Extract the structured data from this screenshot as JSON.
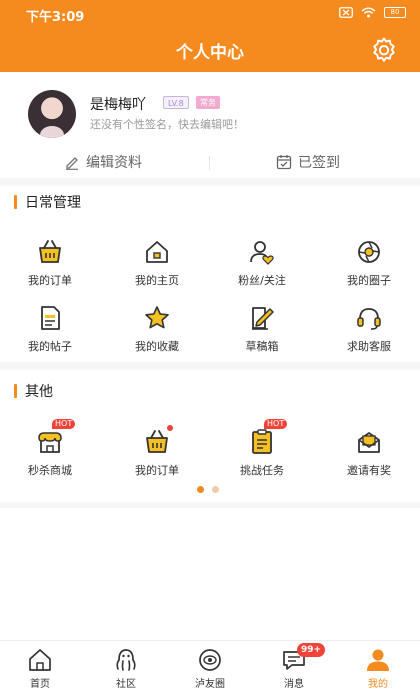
{
  "status_bar": {
    "time": "下午3:09",
    "battery": "80"
  },
  "header": {
    "title": "个人中心",
    "settings_icon": "gear-icon"
  },
  "profile": {
    "username": "是梅梅吖",
    "level_badge": "LV.8",
    "vip_badge": "常务",
    "signature": "还没有个性签名，快去编辑吧！"
  },
  "actions": {
    "edit_label": "编辑资料",
    "signin_label": "已签到"
  },
  "daily": {
    "title": "日常管理",
    "items": [
      {
        "label": "我的订单",
        "icon": "basket-icon"
      },
      {
        "label": "我的主页",
        "icon": "home-icon"
      },
      {
        "label": "粉丝/关注",
        "icon": "user-heart-icon"
      },
      {
        "label": "我的圈子",
        "icon": "aperture-icon"
      },
      {
        "label": "我的帖子",
        "icon": "document-icon"
      },
      {
        "label": "我的收藏",
        "icon": "star-icon"
      },
      {
        "label": "草稿箱",
        "icon": "pen-note-icon"
      },
      {
        "label": "求助客服",
        "icon": "headset-icon"
      }
    ]
  },
  "other": {
    "title": "其他",
    "items": [
      {
        "label": "秒杀商城",
        "icon": "shop-icon",
        "badge": "HOT"
      },
      {
        "label": "我的订单",
        "icon": "basket-icon"
      },
      {
        "label": "挑战任务",
        "icon": "clipboard-icon",
        "badge": "HOT"
      },
      {
        "label": "邀请有奖",
        "icon": "envelope-icon"
      }
    ]
  },
  "tabbar": {
    "tabs": [
      {
        "label": "首页",
        "icon": "home-icon"
      },
      {
        "label": "社区",
        "icon": "octopus-icon"
      },
      {
        "label": "泸友圈",
        "icon": "target-icon"
      },
      {
        "label": "消息",
        "icon": "chat-bubble-icon",
        "badge": "99+"
      },
      {
        "label": "我的",
        "icon": "person-icon"
      }
    ]
  },
  "colors": {
    "accent": "#f58a1f",
    "badge_red": "#f0443a",
    "icon_dark": "#333333",
    "icon_yellow": "#f5c023"
  }
}
